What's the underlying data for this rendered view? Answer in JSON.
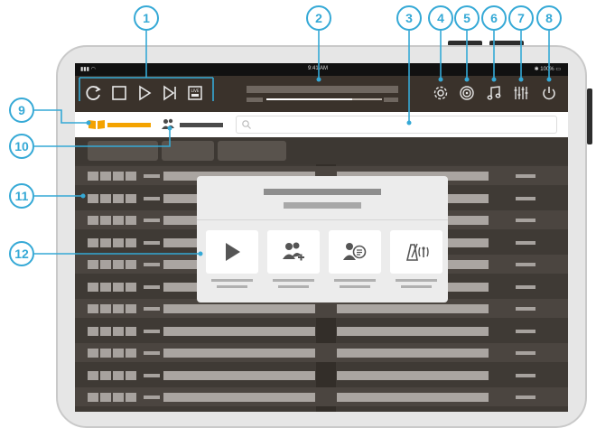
{
  "callouts": [
    {
      "id": "1",
      "label": "1"
    },
    {
      "id": "2",
      "label": "2"
    },
    {
      "id": "3",
      "label": "3"
    },
    {
      "id": "4",
      "label": "4"
    },
    {
      "id": "5",
      "label": "5"
    },
    {
      "id": "6",
      "label": "6"
    },
    {
      "id": "7",
      "label": "7"
    },
    {
      "id": "8",
      "label": "8"
    },
    {
      "id": "9",
      "label": "9"
    },
    {
      "id": "10",
      "label": "10"
    },
    {
      "id": "11",
      "label": "11"
    },
    {
      "id": "12",
      "label": "12"
    }
  ],
  "status_bar": {
    "time": "9:41 AM",
    "battery": "100%"
  },
  "toolbar": {
    "icons": [
      "refresh-icon",
      "stop-icon",
      "play-icon",
      "skip-forward-icon",
      "live-icon"
    ],
    "live_label": "LIVE",
    "right_icons": [
      "settings-icon",
      "speaker-icon",
      "music-note-icon",
      "equalizer-icon",
      "power-icon"
    ]
  },
  "now_playing": {
    "progress": 0.74
  },
  "colors": {
    "accent": "#f4a300",
    "callout": "#35a9d6",
    "toolbar": "#3a322b",
    "screen": "#3f3a35"
  },
  "modal": {
    "buttons": [
      "play-icon",
      "people-add-icon",
      "person-list-icon",
      "metronome-icon"
    ]
  }
}
